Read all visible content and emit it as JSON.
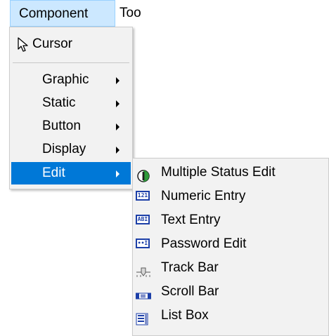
{
  "menubar": {
    "items": [
      {
        "label": "Component"
      },
      {
        "label": "Tools"
      }
    ]
  },
  "component_menu": {
    "items": [
      {
        "label": "Cursor",
        "icon": "cursor-arrow-icon"
      },
      {
        "label": "Graphic",
        "has_submenu": true
      },
      {
        "label": "Static",
        "has_submenu": true
      },
      {
        "label": "Button",
        "has_submenu": true
      },
      {
        "label": "Display",
        "has_submenu": true
      },
      {
        "label": "Edit",
        "has_submenu": true,
        "selected": true
      }
    ]
  },
  "edit_submenu": {
    "items": [
      {
        "label": "Multiple Status Edit",
        "icon": "multiple-status-edit-icon",
        "icon_text": ""
      },
      {
        "label": "Numeric Entry",
        "icon": "numeric-entry-icon",
        "icon_text": "121"
      },
      {
        "label": "Text Entry",
        "icon": "text-entry-icon",
        "icon_text": "ABI"
      },
      {
        "label": "Password Edit",
        "icon": "password-edit-icon",
        "icon_text": "••I"
      },
      {
        "label": "Track Bar",
        "icon": "track-bar-icon",
        "icon_text": ""
      },
      {
        "label": "Scroll Bar",
        "icon": "scroll-bar-icon",
        "icon_text": ""
      },
      {
        "label": "List Box",
        "icon": "list-box-icon",
        "icon_text": ""
      }
    ]
  },
  "colors": {
    "selected_bg": "#0078d7",
    "menu_bg": "#f2f2f2",
    "menubar_active_bg": "#cce8ff",
    "icon_blue": "#1c3fa8"
  }
}
